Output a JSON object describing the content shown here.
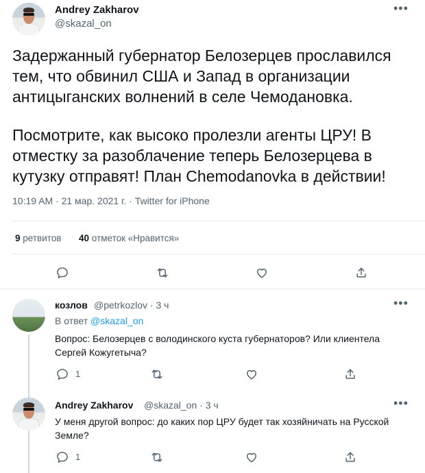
{
  "main_tweet": {
    "author_name": "Andrey Zakharov",
    "author_handle": "@skazal_on",
    "paragraph1": "Задержанный губернатор Белозерцев прославился тем, что обвинил США и Запад в организации антицыганских волнений в селе Чемодановка.",
    "paragraph2": "Посмотрите, как высоко пролезли агенты ЦРУ! В отместку за разоблачение теперь Белозерцева в кутузку отправят! План Chemodanovka в действии!",
    "meta": "10:19 AM · 21 мар. 2021 г. · Twitter for iPhone",
    "retweets_count": "9",
    "retweets_label": "ретвитов",
    "likes_count": "40",
    "likes_label": "отметок «Нравится»"
  },
  "replies": [
    {
      "name": "козлов",
      "handle": "@petrkozlov · 3 ч",
      "reply_prefix": "В ответ ",
      "reply_link": "@skazal_on",
      "text": "Вопрос: Белозерцев с володинского куста губернаторов? Или клиентела Сергей Кожугетыча?",
      "reply_count": "1"
    },
    {
      "name": "Andrey Zakharov",
      "handle": "@skazal_on · 3 ч",
      "text": "У меня другой вопрос: до каких пор ЦРУ будет так хозяйничать на Русской Земле?",
      "reply_count": "1"
    }
  ],
  "icons": {
    "reply": "comment-icon",
    "retweet": "retweet-icon",
    "like": "heart-icon",
    "share": "share-icon",
    "more": "more-icon"
  },
  "colors": {
    "text": "#0f1419",
    "secondary": "#536471",
    "link": "#1d9bf0",
    "divider": "#e6e9ea"
  }
}
